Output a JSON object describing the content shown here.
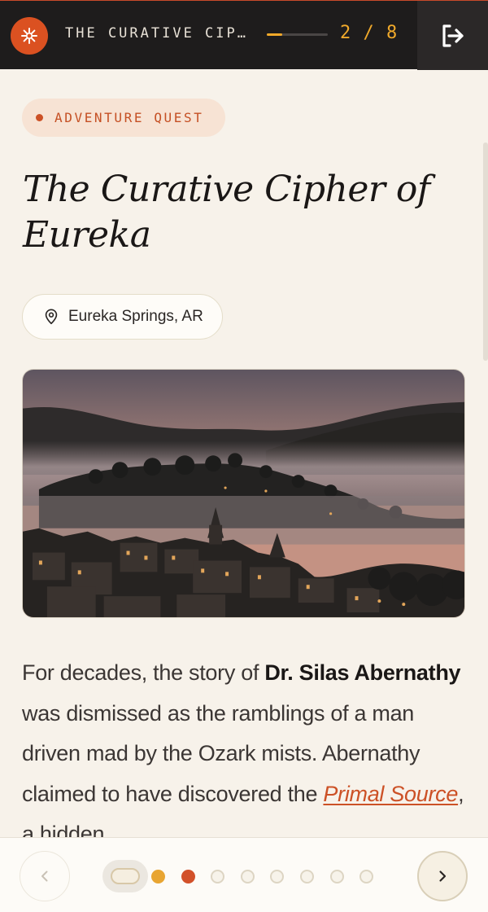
{
  "header": {
    "logo_icon": "sparkle-icon",
    "title": "THE CURATIVE CIP…",
    "progress": 0.25,
    "page_counter": "2 / 8",
    "exit_icon": "exit-icon",
    "colors": {
      "bar": "#1e1c1c",
      "accent": "#db5121",
      "highlight": "#f0a92b"
    }
  },
  "quest": {
    "category": "ADVENTURE QUEST",
    "title": "The Curative Cipher of Eureka",
    "location": "Eureka Springs, AR",
    "location_icon": "map-pin-icon",
    "image_description_icon": "landscape-photo",
    "body": {
      "p1": "For decades, the story of ",
      "name": "Dr. Silas Abernathy",
      "p2": " was dismissed as the ramblings of a man driven mad by the Ozark mists. Abernathy claimed to have discovered the ",
      "source": "Primal Source",
      "p3": ", a hidden"
    }
  },
  "navigation": {
    "prev_icon": "chevron-left-icon",
    "next_icon": "chevron-right-icon",
    "cover_icon": "cover-pill-icon",
    "dots": [
      {
        "state": "visited",
        "color": "#e8a532"
      },
      {
        "state": "current",
        "color": "#d2512a"
      },
      {
        "state": "upcoming",
        "color": "#e8e1d1"
      },
      {
        "state": "upcoming",
        "color": "#e8e1d1"
      },
      {
        "state": "upcoming",
        "color": "#e8e1d1"
      },
      {
        "state": "upcoming",
        "color": "#e8e1d1"
      },
      {
        "state": "upcoming",
        "color": "#e8e1d1"
      },
      {
        "state": "upcoming",
        "color": "#e8e1d1"
      }
    ]
  }
}
